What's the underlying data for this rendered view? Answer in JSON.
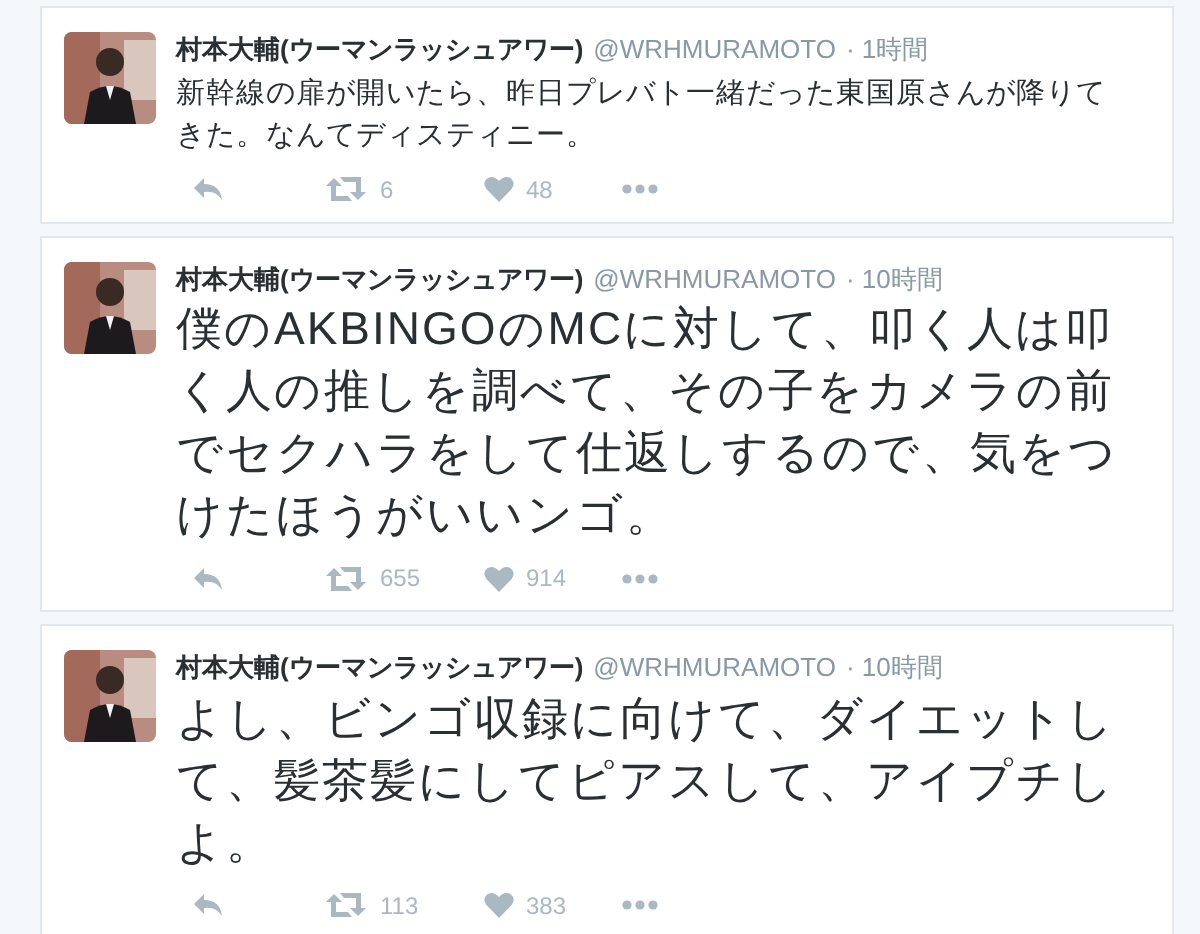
{
  "tweets": [
    {
      "name": "村本大輔(ウーマンラッシュアワー)",
      "handle": "@WRHMURAMOTO",
      "time": "· 1時間",
      "kind": "regular",
      "text": "新幹線の扉が開いたら、昨日プレバト一緒だった東国原さんが降りてきた。なんてディスティニー。",
      "retweets": "6",
      "likes": "48"
    },
    {
      "name": "村本大輔(ウーマンラッシュアワー)",
      "handle": "@WRHMURAMOTO",
      "time": "· 10時間",
      "kind": "large",
      "text": "僕のAKBINGOのMCに対して、叩く人は叩く人の推しを調べて、その子をカメラの前でセクハラをして仕返しするので、気をつけたほうがいいンゴ。",
      "retweets": "655",
      "likes": "914"
    },
    {
      "name": "村本大輔(ウーマンラッシュアワー)",
      "handle": "@WRHMURAMOTO",
      "time": "· 10時間",
      "kind": "large",
      "text": "よし、ビンゴ収録に向けて、ダイエットして、髪茶髪にしてピアスして、アイプチしよ。",
      "retweets": "113",
      "likes": "383"
    }
  ]
}
